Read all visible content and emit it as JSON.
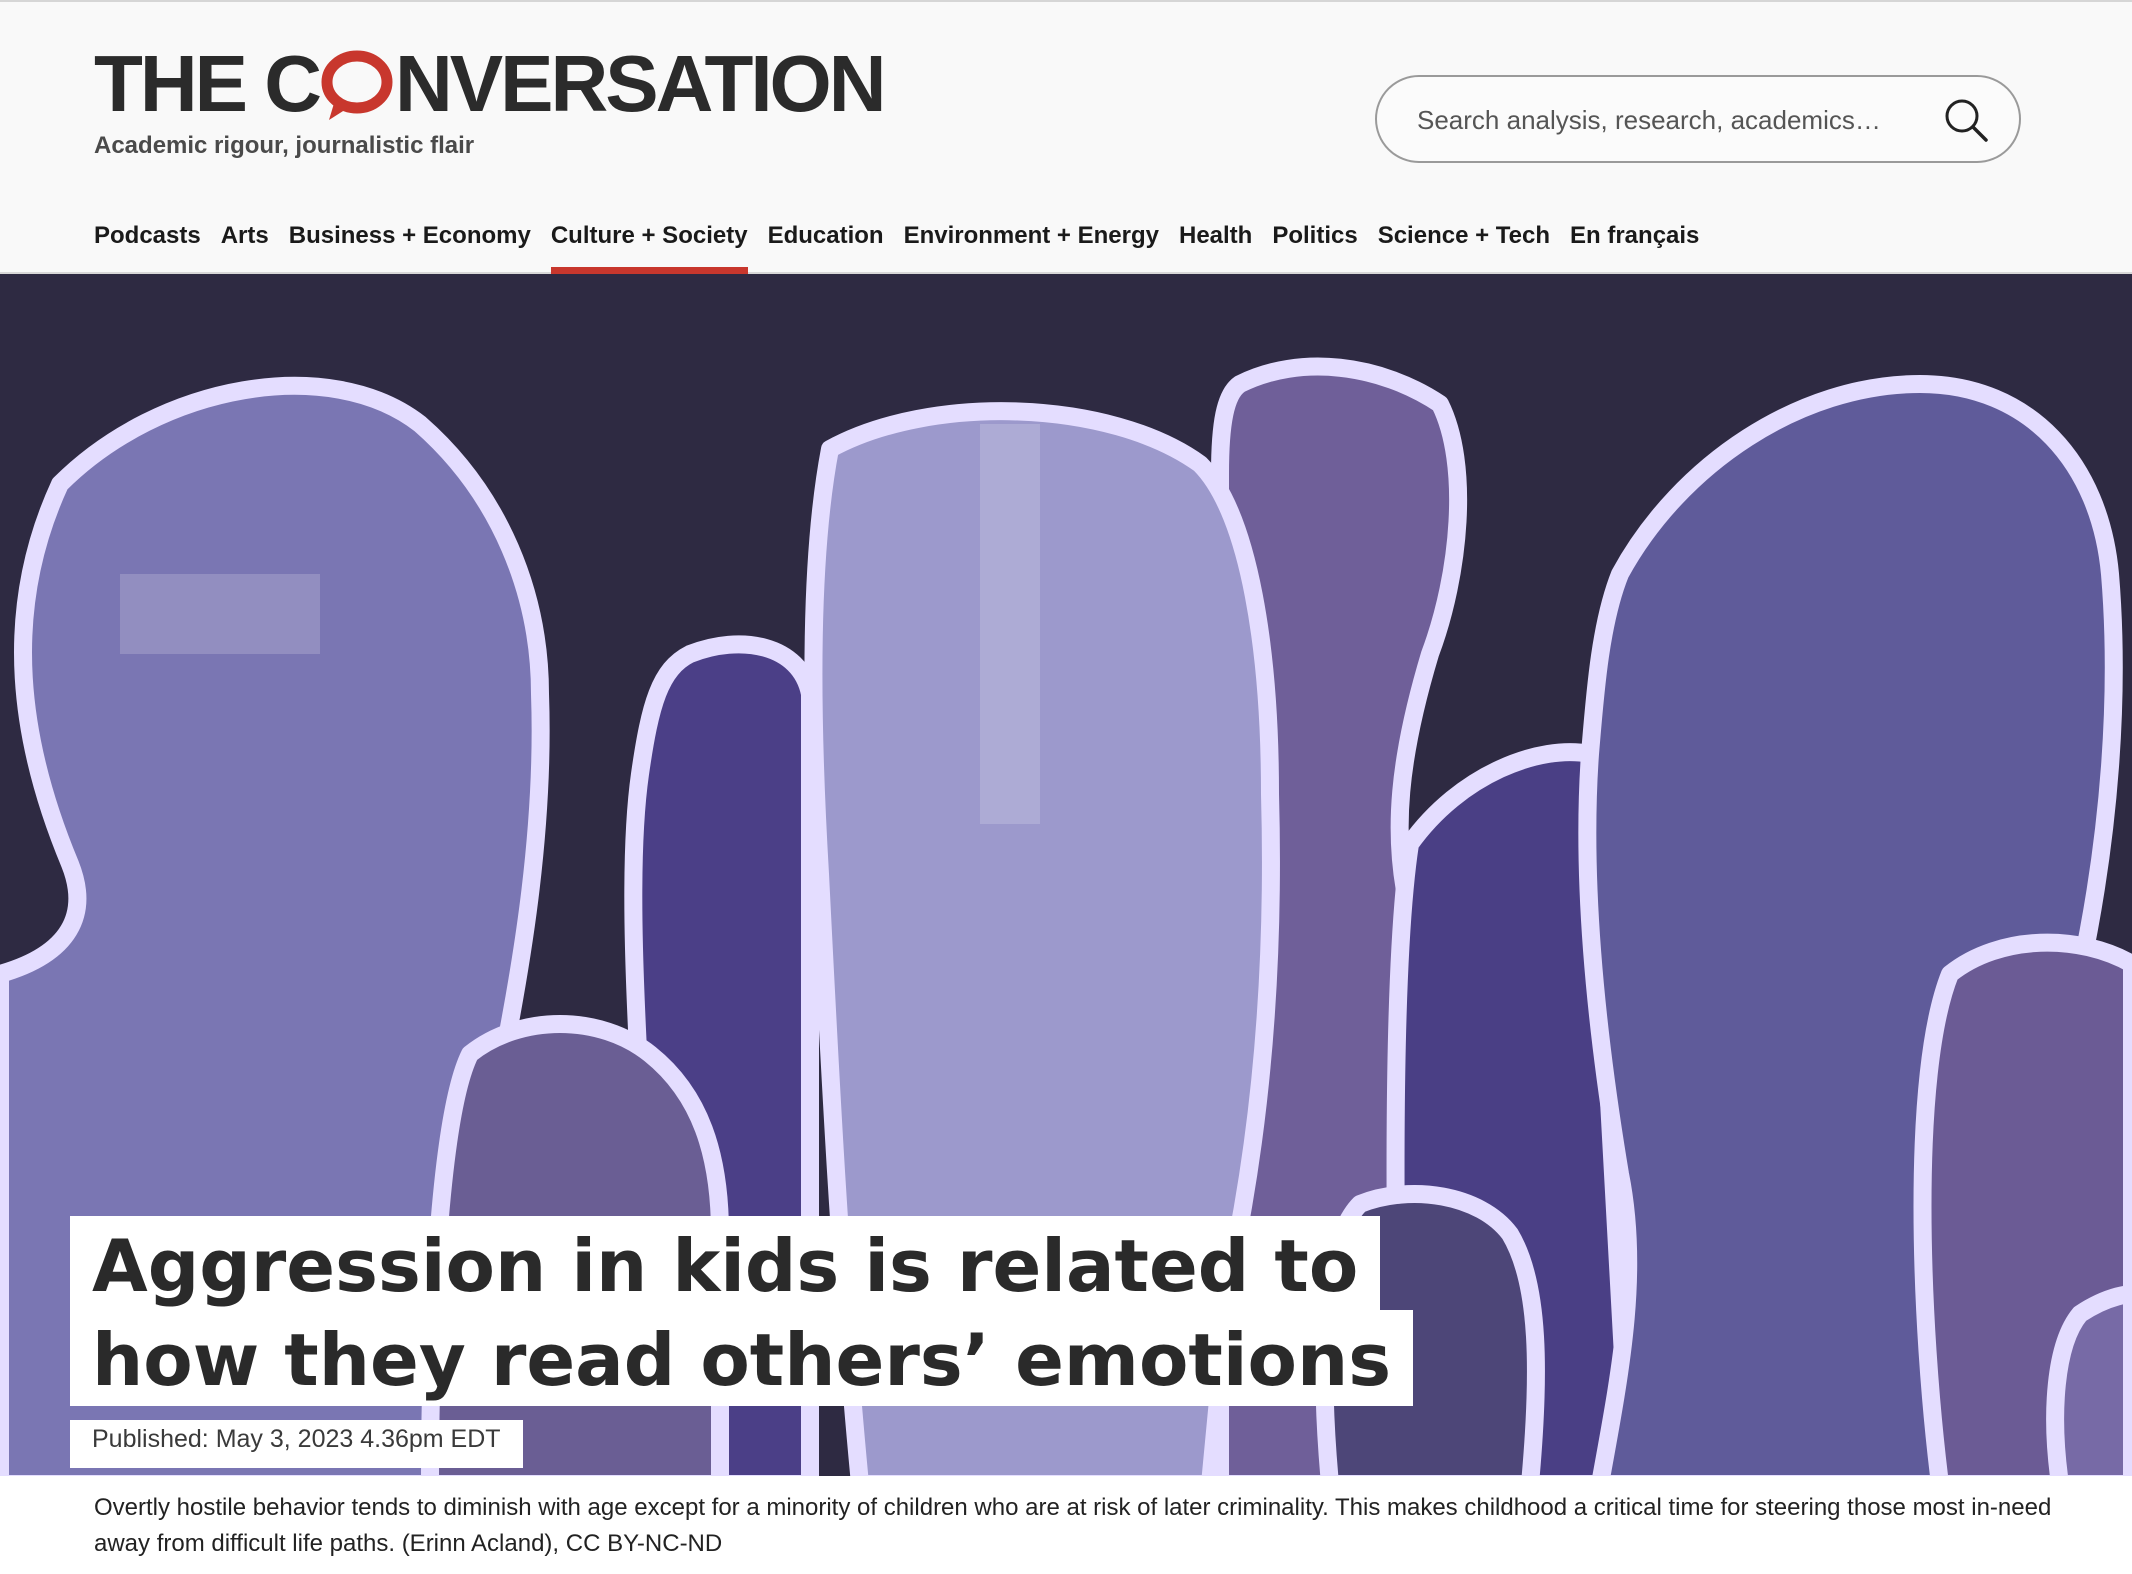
{
  "site": {
    "logo_text_left": "THE C",
    "logo_text_right": "NVERSATION",
    "logo_full": "THE CONVERSATION",
    "tagline": "Academic rigour, journalistic flair",
    "brand_color": "#c8372d"
  },
  "search": {
    "placeholder": "Search analysis, research, academics…",
    "icon": "search-icon"
  },
  "nav": {
    "items": [
      {
        "label": "Podcasts",
        "active": false
      },
      {
        "label": "Arts",
        "active": false
      },
      {
        "label": "Business + Economy",
        "active": false
      },
      {
        "label": "Culture + Society",
        "active": true
      },
      {
        "label": "Education",
        "active": false
      },
      {
        "label": "Environment + Energy",
        "active": false
      },
      {
        "label": "Health",
        "active": false
      },
      {
        "label": "Politics",
        "active": false
      },
      {
        "label": "Science + Tech",
        "active": false
      },
      {
        "label": "En français",
        "active": false
      }
    ]
  },
  "article": {
    "title_line1": "Aggression in kids is related to",
    "title_line2": "how they read others’ emotions",
    "published": "Published: May 3, 2023 4.36pm EDT",
    "caption": "Overtly hostile behavior tends to diminish with age except for a minority of children who are at risk of later criminality. This makes childhood a critical time for steering those most in-need away from difficult life paths. (Erinn Acland), CC BY-NC-ND"
  }
}
